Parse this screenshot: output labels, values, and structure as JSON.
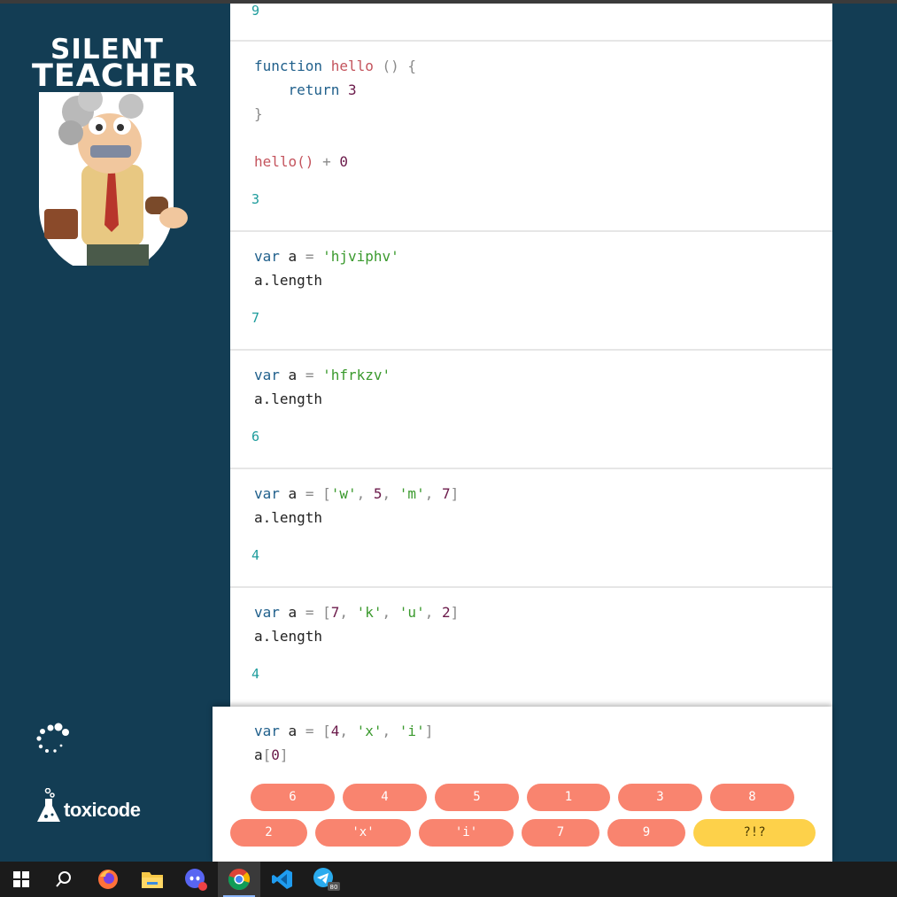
{
  "sidebar": {
    "logo_line1": "SILENT",
    "logo_line2": "TEACHER",
    "brand": "toxicode"
  },
  "cards": [
    {
      "id": "prev",
      "result": "9"
    },
    {
      "id": "fn",
      "code_fn": "function",
      "code_name": "hello",
      "code_rest": " () {",
      "code_return": "return",
      "code_return_val": "3",
      "code_close": "}",
      "code_call": "hello()",
      "code_plus": " + ",
      "code_arg": "0",
      "result": "3"
    },
    {
      "id": "s1",
      "kw": "var",
      "name": " a ",
      "eq": "= ",
      "value": "'hjviphv'",
      "line2": "a.length",
      "result": "7"
    },
    {
      "id": "s2",
      "kw": "var",
      "name": " a ",
      "eq": "= ",
      "value": "'hfrkzv'",
      "line2": "a.length",
      "result": "6"
    },
    {
      "id": "a1",
      "kw": "var",
      "name": " a ",
      "eq": "= ",
      "array": [
        "'w'",
        "5",
        "'m'",
        "7"
      ],
      "line2": "a.length",
      "result": "4"
    },
    {
      "id": "a2",
      "kw": "var",
      "name": " a ",
      "eq": "= ",
      "array": [
        "7",
        "'k'",
        "'u'",
        "2"
      ],
      "line2": "a.length",
      "result": "4"
    }
  ],
  "active": {
    "kw": "var",
    "name": " a ",
    "eq": "= ",
    "array": [
      "4",
      "'x'",
      "'i'"
    ],
    "line2_var": "a",
    "line2_index": "0"
  },
  "answers": {
    "row1": [
      "6",
      "4",
      "5",
      "1",
      "3",
      "8"
    ],
    "row2": [
      "2",
      "'x'",
      "'i'",
      "7",
      "9"
    ],
    "help": "?!?"
  },
  "taskbar": {
    "items": [
      "start-icon",
      "search-icon",
      "firefox-icon",
      "file-explorer-icon",
      "discord-icon",
      "chrome-icon",
      "vscode-icon",
      "telegram-icon"
    ],
    "telegram_badge": "80"
  },
  "colors": {
    "background": "#133d54",
    "answer_button": "#f9846f",
    "help_button": "#fdd14a",
    "result_text": "#1d9c9c"
  }
}
